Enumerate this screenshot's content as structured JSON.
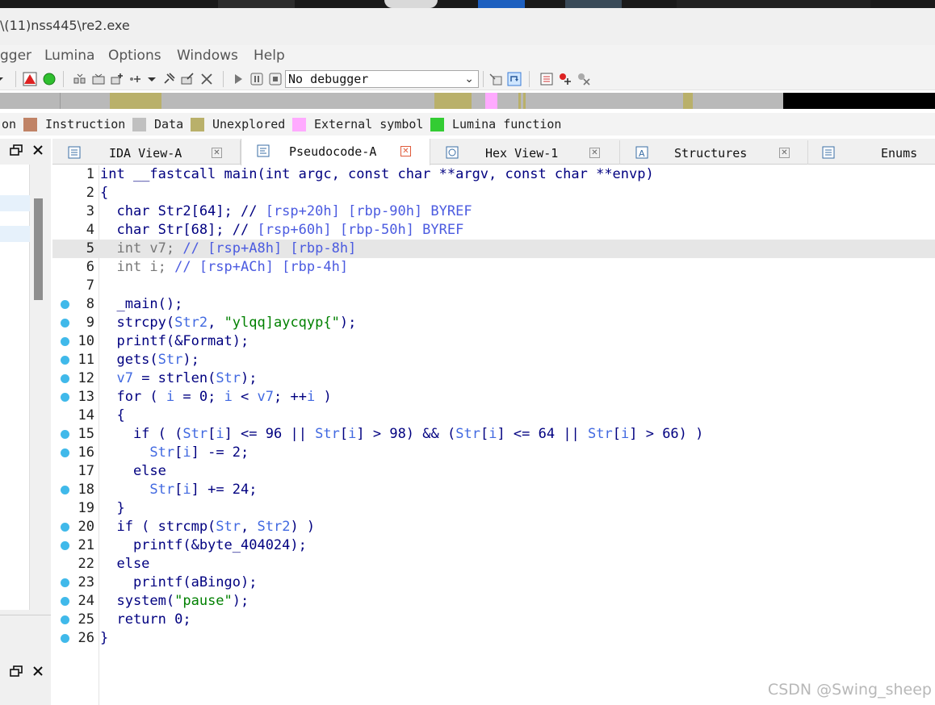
{
  "window": {
    "title": "\\(11)nss445\\re2.exe"
  },
  "menu": [
    "gger",
    "Lumina",
    "Options",
    "Windows",
    "Help"
  ],
  "toolbar": {
    "debugger_selected": "No debugger",
    "debugger_options": [
      "No debugger"
    ]
  },
  "legend": [
    {
      "label": "on",
      "color": ""
    },
    {
      "label": "Instruction",
      "color": "#c08366"
    },
    {
      "label": "Data",
      "color": "#c0c0c0"
    },
    {
      "label": "Unexplored",
      "color": "#b9b06a"
    },
    {
      "label": "External symbol",
      "color": "#ffaaff"
    },
    {
      "label": "Lumina function",
      "color": "#33cc33"
    }
  ],
  "tabs": [
    {
      "label": "IDA View-A",
      "active": false
    },
    {
      "label": "Pseudocode-A",
      "active": true
    },
    {
      "label": "Hex View-1",
      "active": false
    },
    {
      "label": "Structures",
      "active": false
    },
    {
      "label": "Enums",
      "active": false
    }
  ],
  "code": [
    {
      "n": "1",
      "bp": false,
      "hl": false,
      "tokens": [
        [
          "k",
          "int __fastcall main(int argc, const char **argv, const char **envp)"
        ]
      ]
    },
    {
      "n": "2",
      "bp": false,
      "hl": false,
      "tokens": [
        [
          "k",
          "{"
        ]
      ]
    },
    {
      "n": "3",
      "bp": false,
      "hl": false,
      "tokens": [
        [
          "k",
          "  char Str2[64]; // "
        ],
        [
          "cr",
          "[rsp+20h] [rbp-90h] BYREF"
        ]
      ]
    },
    {
      "n": "4",
      "bp": false,
      "hl": false,
      "tokens": [
        [
          "k",
          "  char Str[68]; // "
        ],
        [
          "cr",
          "[rsp+60h] [rbp-50h] BYREF"
        ]
      ]
    },
    {
      "n": "5",
      "bp": false,
      "hl": true,
      "tokens": [
        [
          "gr",
          "  int v7; "
        ],
        [
          "cr",
          "// [rsp+A8h] [rbp-8h]"
        ]
      ]
    },
    {
      "n": "6",
      "bp": false,
      "hl": false,
      "tokens": [
        [
          "gr",
          "  int i; "
        ],
        [
          "cr",
          "// [rsp+ACh] [rbp-4h]"
        ]
      ]
    },
    {
      "n": "7",
      "bp": false,
      "hl": false,
      "tokens": [
        [
          "k",
          ""
        ]
      ]
    },
    {
      "n": "8",
      "bp": true,
      "hl": false,
      "tokens": [
        [
          "k",
          "  _main();"
        ]
      ]
    },
    {
      "n": "9",
      "bp": true,
      "hl": false,
      "tokens": [
        [
          "k",
          "  strcpy("
        ],
        [
          "v",
          "Str2"
        ],
        [
          "k",
          ", "
        ],
        [
          "s",
          "\"ylqq]aycqyp{\""
        ],
        [
          "k",
          ");"
        ]
      ]
    },
    {
      "n": "10",
      "bp": true,
      "hl": false,
      "tokens": [
        [
          "k",
          "  printf(&Format);"
        ]
      ]
    },
    {
      "n": "11",
      "bp": true,
      "hl": false,
      "tokens": [
        [
          "k",
          "  gets("
        ],
        [
          "v",
          "Str"
        ],
        [
          "k",
          ");"
        ]
      ]
    },
    {
      "n": "12",
      "bp": true,
      "hl": false,
      "tokens": [
        [
          "v",
          "  v7"
        ],
        [
          "k",
          " = strlen("
        ],
        [
          "v",
          "Str"
        ],
        [
          "k",
          ");"
        ]
      ]
    },
    {
      "n": "13",
      "bp": true,
      "hl": false,
      "tokens": [
        [
          "k",
          "  for ( "
        ],
        [
          "v",
          "i"
        ],
        [
          "k",
          " = 0; "
        ],
        [
          "v",
          "i"
        ],
        [
          "k",
          " < "
        ],
        [
          "v",
          "v7"
        ],
        [
          "k",
          "; ++"
        ],
        [
          "v",
          "i"
        ],
        [
          "k",
          " )"
        ]
      ]
    },
    {
      "n": "14",
      "bp": false,
      "hl": false,
      "tokens": [
        [
          "k",
          "  {"
        ]
      ]
    },
    {
      "n": "15",
      "bp": true,
      "hl": false,
      "tokens": [
        [
          "k",
          "    if ( ("
        ],
        [
          "v",
          "Str"
        ],
        [
          "k",
          "["
        ],
        [
          "v",
          "i"
        ],
        [
          "k",
          "] <= 96 || "
        ],
        [
          "v",
          "Str"
        ],
        [
          "k",
          "["
        ],
        [
          "v",
          "i"
        ],
        [
          "k",
          "] > 98) && ("
        ],
        [
          "v",
          "Str"
        ],
        [
          "k",
          "["
        ],
        [
          "v",
          "i"
        ],
        [
          "k",
          "] <= 64 || "
        ],
        [
          "v",
          "Str"
        ],
        [
          "k",
          "["
        ],
        [
          "v",
          "i"
        ],
        [
          "k",
          "] > 66) )"
        ]
      ]
    },
    {
      "n": "16",
      "bp": true,
      "hl": false,
      "tokens": [
        [
          "v",
          "      Str"
        ],
        [
          "k",
          "["
        ],
        [
          "v",
          "i"
        ],
        [
          "k",
          "] -= 2;"
        ]
      ]
    },
    {
      "n": "17",
      "bp": false,
      "hl": false,
      "tokens": [
        [
          "k",
          "    else"
        ]
      ]
    },
    {
      "n": "18",
      "bp": true,
      "hl": false,
      "tokens": [
        [
          "v",
          "      Str"
        ],
        [
          "k",
          "["
        ],
        [
          "v",
          "i"
        ],
        [
          "k",
          "] += 24;"
        ]
      ]
    },
    {
      "n": "19",
      "bp": false,
      "hl": false,
      "tokens": [
        [
          "k",
          "  }"
        ]
      ]
    },
    {
      "n": "20",
      "bp": true,
      "hl": false,
      "tokens": [
        [
          "k",
          "  if ( strcmp("
        ],
        [
          "v",
          "Str"
        ],
        [
          "k",
          ", "
        ],
        [
          "v",
          "Str2"
        ],
        [
          "k",
          ") )"
        ]
      ]
    },
    {
      "n": "21",
      "bp": true,
      "hl": false,
      "tokens": [
        [
          "k",
          "    printf(&byte_404024);"
        ]
      ]
    },
    {
      "n": "22",
      "bp": false,
      "hl": false,
      "tokens": [
        [
          "k",
          "  else"
        ]
      ]
    },
    {
      "n": "23",
      "bp": true,
      "hl": false,
      "tokens": [
        [
          "k",
          "    printf(aBingo);"
        ]
      ]
    },
    {
      "n": "24",
      "bp": true,
      "hl": false,
      "tokens": [
        [
          "k",
          "  system("
        ],
        [
          "s",
          "\"pause\""
        ],
        [
          "k",
          ");"
        ]
      ]
    },
    {
      "n": "25",
      "bp": true,
      "hl": false,
      "tokens": [
        [
          "k",
          "  return 0;"
        ]
      ]
    },
    {
      "n": "26",
      "bp": true,
      "hl": false,
      "tokens": [
        [
          "k",
          "}"
        ]
      ]
    }
  ],
  "watermark": "CSDN @Swing_sheep"
}
